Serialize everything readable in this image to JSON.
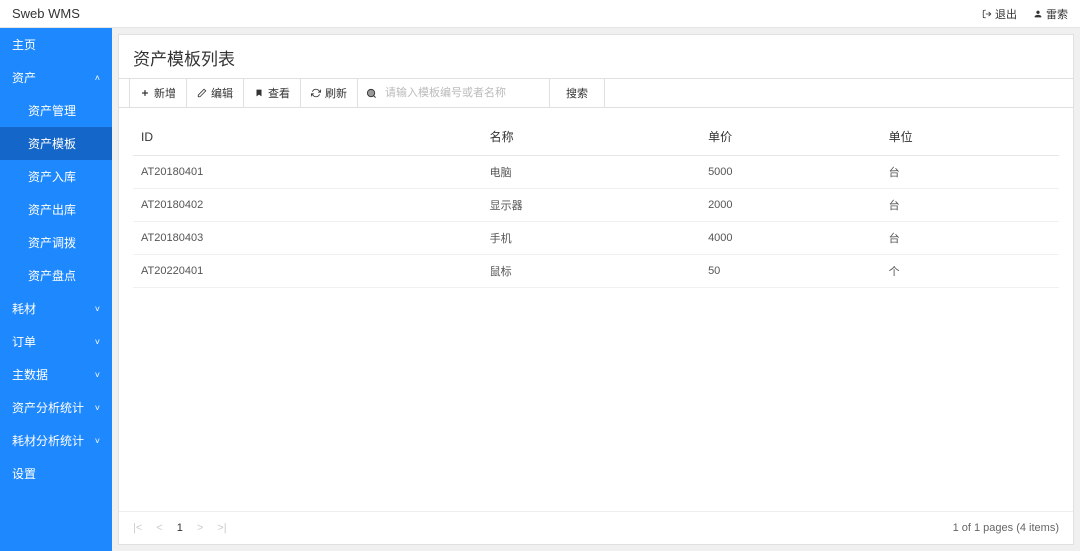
{
  "topbar": {
    "brand": "Sweb WMS",
    "logout": "退出",
    "user": "雷索"
  },
  "sidebar": {
    "items": [
      {
        "label": "主页",
        "expandable": false
      },
      {
        "label": "资产",
        "expandable": true,
        "open": true,
        "children": [
          {
            "label": "资产管理",
            "active": false
          },
          {
            "label": "资产模板",
            "active": true
          },
          {
            "label": "资产入库",
            "active": false
          },
          {
            "label": "资产出库",
            "active": false
          },
          {
            "label": "资产调拨",
            "active": false
          },
          {
            "label": "资产盘点",
            "active": false
          }
        ]
      },
      {
        "label": "耗材",
        "expandable": true,
        "open": false
      },
      {
        "label": "订单",
        "expandable": true,
        "open": false
      },
      {
        "label": "主数据",
        "expandable": true,
        "open": false
      },
      {
        "label": "资产分析统计",
        "expandable": true,
        "open": false
      },
      {
        "label": "耗材分析统计",
        "expandable": true,
        "open": false
      },
      {
        "label": "设置",
        "expandable": false
      }
    ]
  },
  "page": {
    "title": "资产模板列表"
  },
  "toolbar": {
    "add": "新增",
    "edit": "编辑",
    "view": "查看",
    "refresh": "刷新",
    "search_placeholder": "请输入模板编号或者名称",
    "search_btn": "搜索"
  },
  "table": {
    "columns": [
      "ID",
      "名称",
      "单价",
      "单位"
    ],
    "rows": [
      {
        "id": "AT20180401",
        "name": "电脑",
        "price": "5000",
        "unit": "台"
      },
      {
        "id": "AT20180402",
        "name": "显示器",
        "price": "2000",
        "unit": "台"
      },
      {
        "id": "AT20180403",
        "name": "手机",
        "price": "4000",
        "unit": "台"
      },
      {
        "id": "AT20220401",
        "name": "鼠标",
        "price": "50",
        "unit": "个"
      }
    ]
  },
  "pagination": {
    "current_page": "1",
    "info": "1 of 1 pages (4 items)"
  }
}
